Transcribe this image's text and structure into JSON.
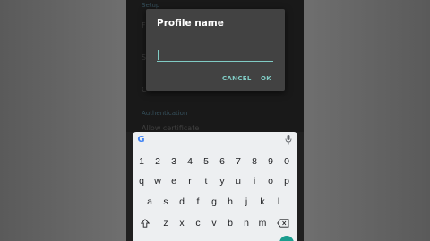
{
  "settings": {
    "section_header": "Setup",
    "header2": "Authentication",
    "item3": "Allow certificate"
  },
  "dialog": {
    "title": "Profile name",
    "input_value": "",
    "cancel_label": "CANCEL",
    "ok_label": "OK"
  },
  "keyboard": {
    "row1": [
      "1",
      "2",
      "3",
      "4",
      "5",
      "6",
      "7",
      "8",
      "9",
      "0"
    ],
    "row2": [
      "q",
      "w",
      "e",
      "r",
      "t",
      "y",
      "u",
      "i",
      "o",
      "p"
    ],
    "row3": [
      "a",
      "s",
      "d",
      "f",
      "g",
      "h",
      "j",
      "k",
      "l"
    ],
    "row4": [
      "z",
      "x",
      "c",
      "v",
      "b",
      "n",
      "m"
    ],
    "google_icon": "google-g-icon",
    "mic_icon": "mic-icon",
    "shift_icon": "shift-icon",
    "backspace_icon": "backspace-icon"
  },
  "colors": {
    "accent": "#80cbc4",
    "dialog_bg": "#424242",
    "keyboard_bg": "#edeff1"
  }
}
